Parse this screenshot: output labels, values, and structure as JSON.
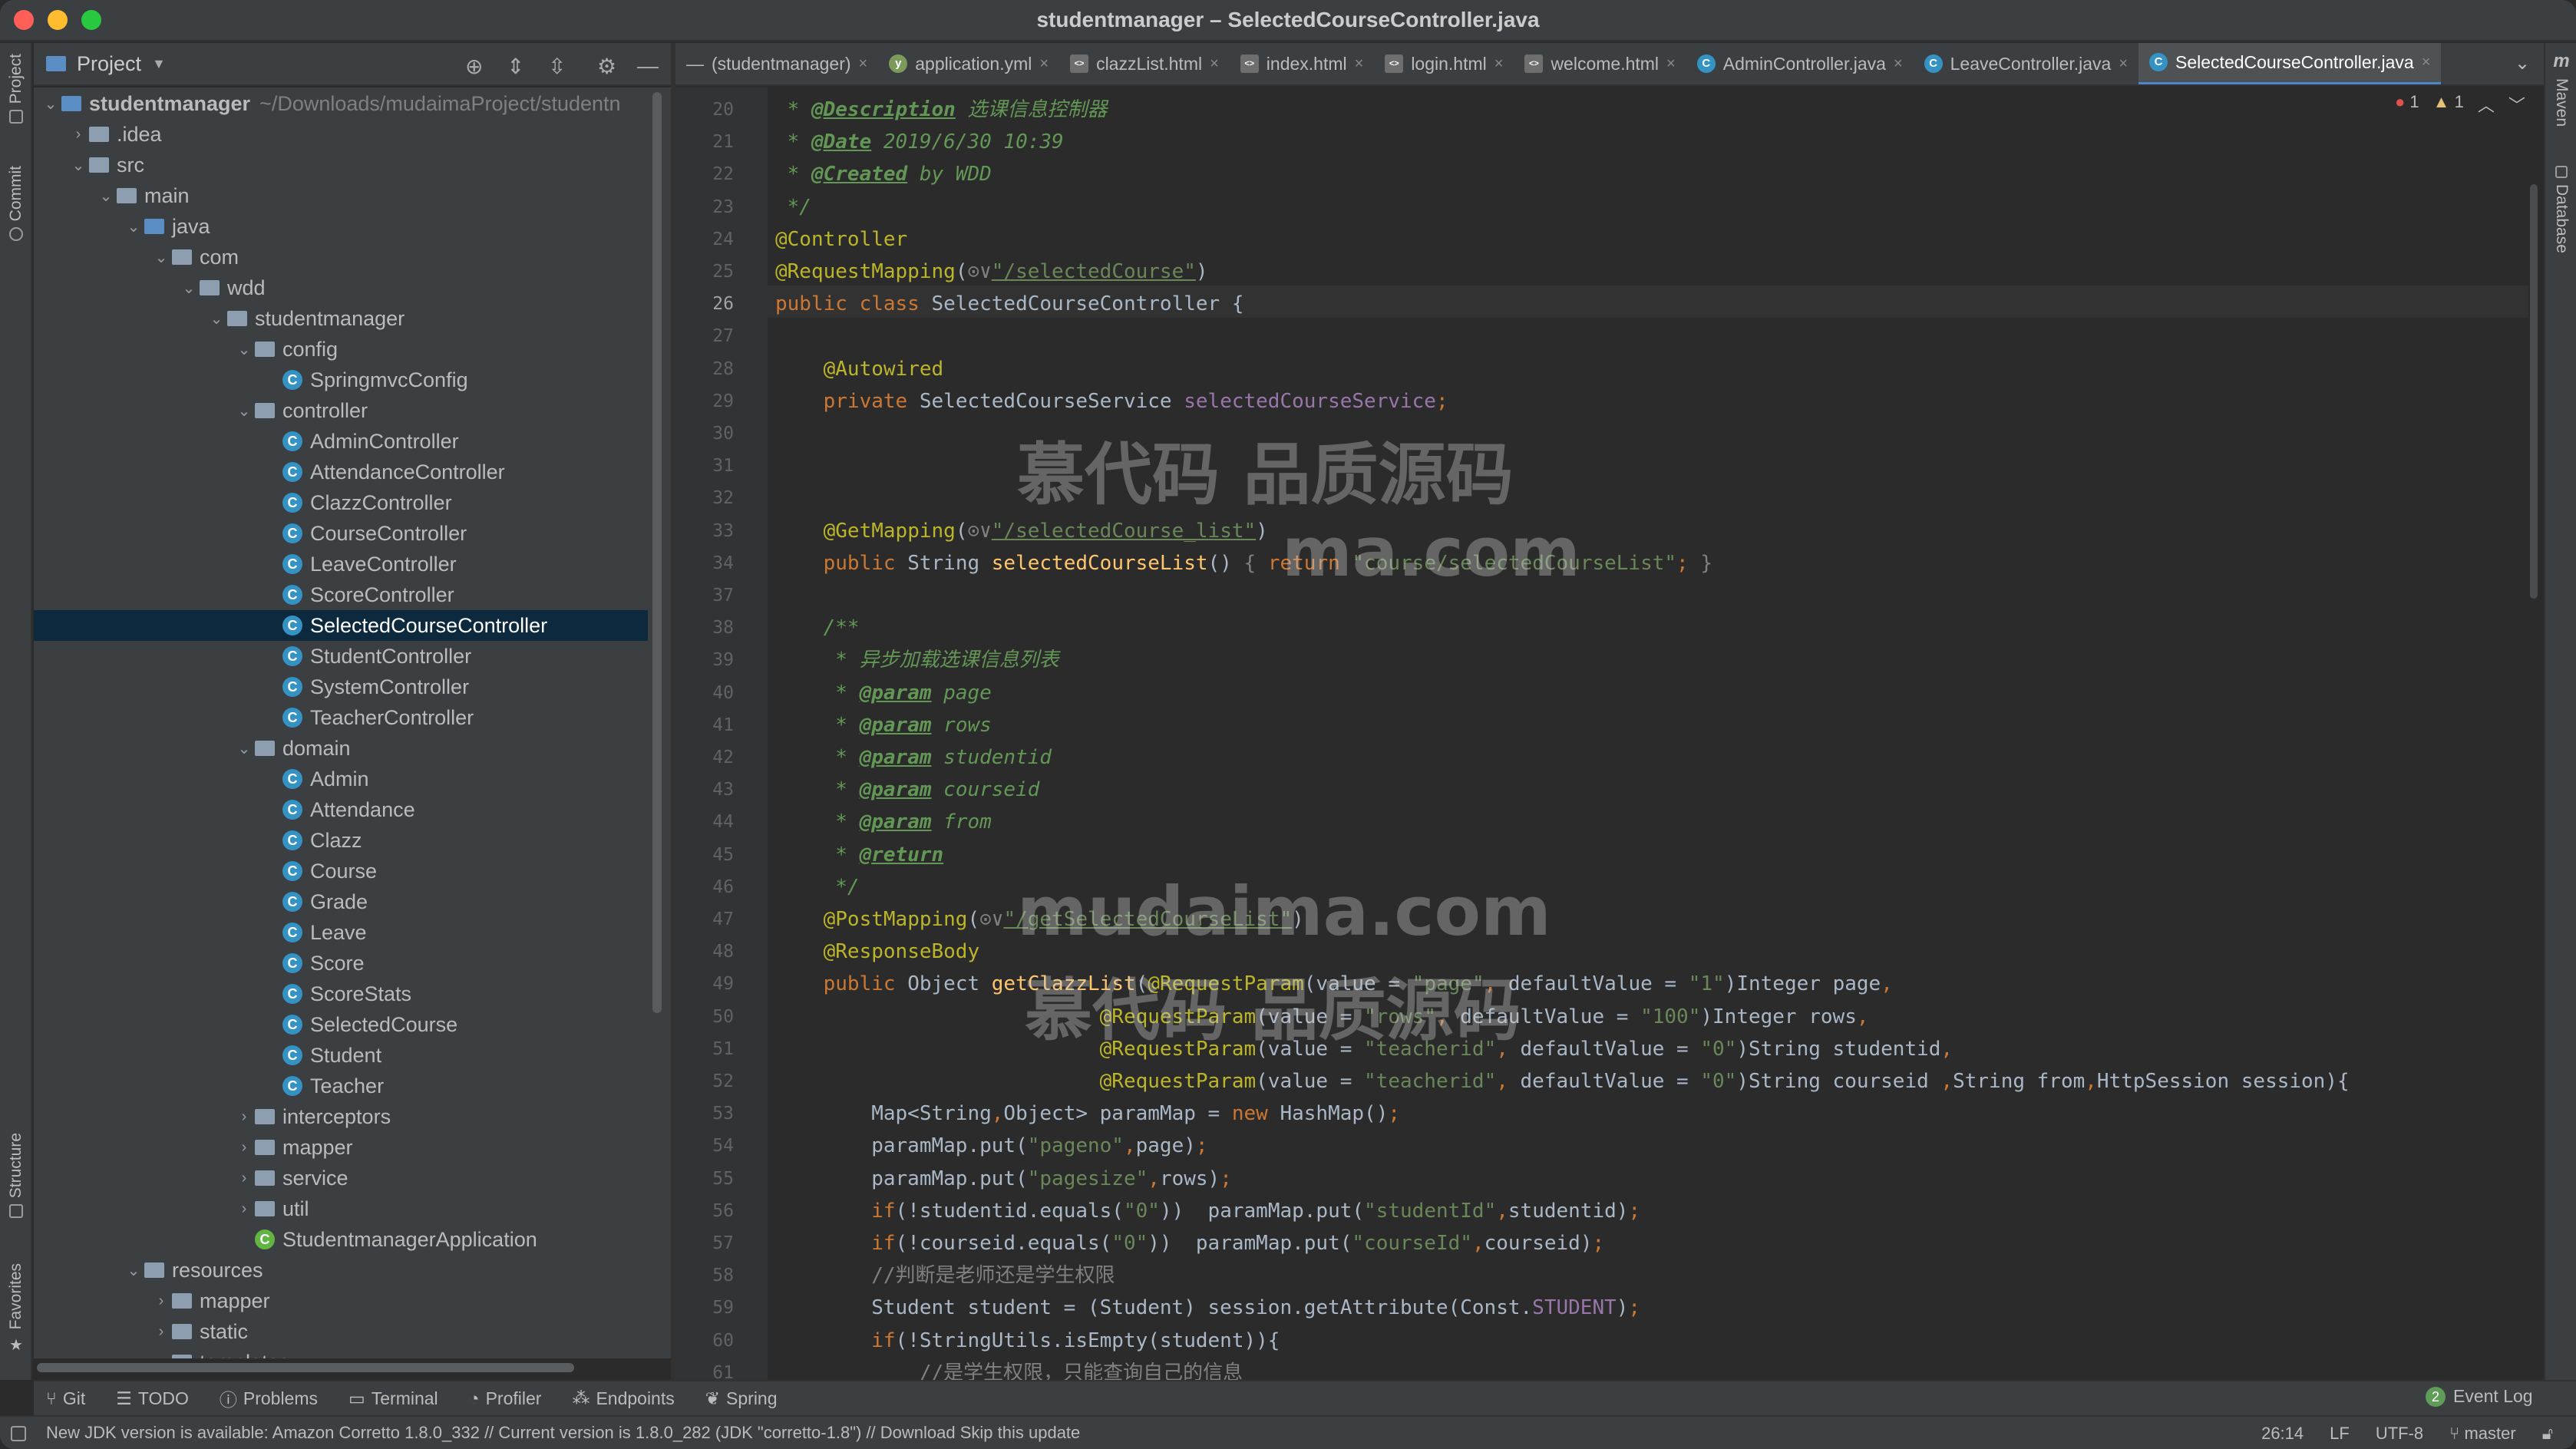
{
  "window": {
    "title": "studentmanager – SelectedCourseController.java"
  },
  "left_strip": {
    "project": "Project",
    "commit": "Commit",
    "structure": "Structure",
    "favorites": "Favorites"
  },
  "right_strip": {
    "maven": "Maven",
    "database": "Database"
  },
  "project_panel": {
    "label": "Project"
  },
  "tree": [
    {
      "label": "studentmanager",
      "suffix": "~/Downloads/mudaimaProject/studentn",
      "indent": 0,
      "type": "module",
      "open": true,
      "bold": true
    },
    {
      "label": ".idea",
      "indent": 1,
      "type": "folder",
      "open": false
    },
    {
      "label": "src",
      "indent": 1,
      "type": "folder",
      "open": true
    },
    {
      "label": "main",
      "indent": 2,
      "type": "folder",
      "open": true
    },
    {
      "label": "java",
      "indent": 3,
      "type": "folder-blue",
      "open": true
    },
    {
      "label": "com",
      "indent": 4,
      "type": "folder",
      "open": true
    },
    {
      "label": "wdd",
      "indent": 5,
      "type": "folder",
      "open": true
    },
    {
      "label": "studentmanager",
      "indent": 6,
      "type": "folder",
      "open": true
    },
    {
      "label": "config",
      "indent": 7,
      "type": "folder",
      "open": true
    },
    {
      "label": "SpringmvcConfig",
      "indent": 8,
      "type": "class"
    },
    {
      "label": "controller",
      "indent": 7,
      "type": "folder",
      "open": true
    },
    {
      "label": "AdminController",
      "indent": 8,
      "type": "class"
    },
    {
      "label": "AttendanceController",
      "indent": 8,
      "type": "class"
    },
    {
      "label": "ClazzController",
      "indent": 8,
      "type": "class"
    },
    {
      "label": "CourseController",
      "indent": 8,
      "type": "class"
    },
    {
      "label": "LeaveController",
      "indent": 8,
      "type": "class"
    },
    {
      "label": "ScoreController",
      "indent": 8,
      "type": "class"
    },
    {
      "label": "SelectedCourseController",
      "indent": 8,
      "type": "class",
      "selected": true
    },
    {
      "label": "StudentController",
      "indent": 8,
      "type": "class"
    },
    {
      "label": "SystemController",
      "indent": 8,
      "type": "class"
    },
    {
      "label": "TeacherController",
      "indent": 8,
      "type": "class"
    },
    {
      "label": "domain",
      "indent": 7,
      "type": "folder",
      "open": true
    },
    {
      "label": "Admin",
      "indent": 8,
      "type": "class"
    },
    {
      "label": "Attendance",
      "indent": 8,
      "type": "class"
    },
    {
      "label": "Clazz",
      "indent": 8,
      "type": "class"
    },
    {
      "label": "Course",
      "indent": 8,
      "type": "class"
    },
    {
      "label": "Grade",
      "indent": 8,
      "type": "class"
    },
    {
      "label": "Leave",
      "indent": 8,
      "type": "class"
    },
    {
      "label": "Score",
      "indent": 8,
      "type": "class"
    },
    {
      "label": "ScoreStats",
      "indent": 8,
      "type": "class"
    },
    {
      "label": "SelectedCourse",
      "indent": 8,
      "type": "class"
    },
    {
      "label": "Student",
      "indent": 8,
      "type": "class"
    },
    {
      "label": "Teacher",
      "indent": 8,
      "type": "class"
    },
    {
      "label": "interceptors",
      "indent": 7,
      "type": "folder",
      "open": false
    },
    {
      "label": "mapper",
      "indent": 7,
      "type": "folder",
      "open": false
    },
    {
      "label": "service",
      "indent": 7,
      "type": "folder",
      "open": false
    },
    {
      "label": "util",
      "indent": 7,
      "type": "folder",
      "open": false
    },
    {
      "label": "StudentmanagerApplication",
      "indent": 7,
      "type": "spring"
    },
    {
      "label": "resources",
      "indent": 3,
      "type": "folder",
      "open": true
    },
    {
      "label": "mapper",
      "indent": 4,
      "type": "folder",
      "open": false
    },
    {
      "label": "static",
      "indent": 4,
      "type": "folder",
      "open": false
    },
    {
      "label": "templates",
      "indent": 4,
      "type": "folder",
      "open": true
    }
  ],
  "tabs": [
    {
      "label": "(studentmanager)",
      "icon": "minus"
    },
    {
      "label": "application.yml",
      "icon": "yml"
    },
    {
      "label": "clazzList.html",
      "icon": "html"
    },
    {
      "label": "index.html",
      "icon": "html"
    },
    {
      "label": "login.html",
      "icon": "html"
    },
    {
      "label": "welcome.html",
      "icon": "html"
    },
    {
      "label": "AdminController.java",
      "icon": "class"
    },
    {
      "label": "LeaveController.java",
      "icon": "class"
    },
    {
      "label": "SelectedCourseController.java",
      "icon": "class",
      "active": true
    }
  ],
  "editor": {
    "errors": "1",
    "warnings": "1",
    "current_line": "26",
    "lines": [
      {
        "n": "20",
        "t": [
          [
            "cmt",
            " * "
          ],
          [
            "tag",
            "@Description"
          ],
          [
            "cmt",
            " 选课信息控制器"
          ]
        ]
      },
      {
        "n": "21",
        "t": [
          [
            "cmt",
            " * "
          ],
          [
            "tag",
            "@Date"
          ],
          [
            "cmt",
            " 2019/6/30 10:39"
          ]
        ]
      },
      {
        "n": "22",
        "t": [
          [
            "cmt",
            " * "
          ],
          [
            "tag",
            "@Created"
          ],
          [
            "cmt",
            " by WDD"
          ]
        ]
      },
      {
        "n": "23",
        "t": [
          [
            "cmt",
            " */"
          ]
        ]
      },
      {
        "n": "24",
        "t": [
          [
            "ann",
            "@Controller"
          ]
        ]
      },
      {
        "n": "25",
        "t": [
          [
            "ann",
            "@RequestMapping"
          ],
          [
            "",
            "("
          ],
          [
            "gray",
            "⊙∨"
          ],
          [
            "url",
            "\"/selectedCourse\""
          ],
          [
            "",
            ")"
          ]
        ]
      },
      {
        "n": "26",
        "t": [
          [
            "kw",
            "public class "
          ],
          [
            "",
            "SelectedCourseController {"
          ]
        ]
      },
      {
        "n": "27",
        "t": []
      },
      {
        "n": "28",
        "t": [
          [
            "",
            "    "
          ],
          [
            "ann",
            "@Autowired"
          ]
        ]
      },
      {
        "n": "29",
        "t": [
          [
            "",
            "    "
          ],
          [
            "kw",
            "private "
          ],
          [
            "",
            "SelectedCourseService "
          ],
          [
            "fld",
            "selectedCourseService"
          ],
          [
            "kw",
            ";"
          ]
        ]
      },
      {
        "n": "30",
        "t": []
      },
      {
        "n": "31",
        "t": []
      },
      {
        "n": "32",
        "t": []
      },
      {
        "n": "33",
        "t": [
          [
            "",
            "    "
          ],
          [
            "ann",
            "@GetMapping"
          ],
          [
            "",
            "("
          ],
          [
            "gray",
            "⊙∨"
          ],
          [
            "url",
            "\"/selectedCourse_list\""
          ],
          [
            "",
            ")"
          ]
        ]
      },
      {
        "n": "34",
        "t": [
          [
            "",
            "    "
          ],
          [
            "kw",
            "public "
          ],
          [
            "",
            "String "
          ],
          [
            "mth",
            "selectedCourseList"
          ],
          [
            "",
            "() "
          ],
          [
            "gray",
            "{ "
          ],
          [
            "kw",
            "return "
          ],
          [
            "str",
            "\"course/selectedCourseList\""
          ],
          [
            "kw",
            "; "
          ],
          [
            "gray",
            "}"
          ]
        ]
      },
      {
        "n": "37",
        "t": []
      },
      {
        "n": "38",
        "t": [
          [
            "",
            "    "
          ],
          [
            "cmt",
            "/**"
          ]
        ]
      },
      {
        "n": "39",
        "t": [
          [
            "",
            "    "
          ],
          [
            "cmt",
            " * 异步加载选课信息列表"
          ]
        ]
      },
      {
        "n": "40",
        "t": [
          [
            "",
            "    "
          ],
          [
            "cmt",
            " * "
          ],
          [
            "tag",
            "@param"
          ],
          [
            "cmt",
            " page"
          ]
        ]
      },
      {
        "n": "41",
        "t": [
          [
            "",
            "    "
          ],
          [
            "cmt",
            " * "
          ],
          [
            "tag",
            "@param"
          ],
          [
            "cmt",
            " rows"
          ]
        ]
      },
      {
        "n": "42",
        "t": [
          [
            "",
            "    "
          ],
          [
            "cmt",
            " * "
          ],
          [
            "tag",
            "@param"
          ],
          [
            "cmt",
            " studentid"
          ]
        ]
      },
      {
        "n": "43",
        "t": [
          [
            "",
            "    "
          ],
          [
            "cmt",
            " * "
          ],
          [
            "tag",
            "@param"
          ],
          [
            "cmt",
            " courseid"
          ]
        ]
      },
      {
        "n": "44",
        "t": [
          [
            "",
            "    "
          ],
          [
            "cmt",
            " * "
          ],
          [
            "tag",
            "@param"
          ],
          [
            "cmt",
            " from"
          ]
        ]
      },
      {
        "n": "45",
        "t": [
          [
            "",
            "    "
          ],
          [
            "cmt",
            " * "
          ],
          [
            "tag",
            "@return"
          ]
        ]
      },
      {
        "n": "46",
        "t": [
          [
            "",
            "    "
          ],
          [
            "cmt",
            " */"
          ]
        ]
      },
      {
        "n": "47",
        "t": [
          [
            "",
            "    "
          ],
          [
            "ann",
            "@PostMapping"
          ],
          [
            "",
            "("
          ],
          [
            "gray",
            "⊙∨"
          ],
          [
            "url",
            "\"/getSelectedCourseList\""
          ],
          [
            "",
            ")"
          ]
        ]
      },
      {
        "n": "48",
        "t": [
          [
            "",
            "    "
          ],
          [
            "ann",
            "@ResponseBody"
          ]
        ]
      },
      {
        "n": "49",
        "t": [
          [
            "",
            "    "
          ],
          [
            "kw",
            "public "
          ],
          [
            "",
            "Object "
          ],
          [
            "mth",
            "getClazzList"
          ],
          [
            "",
            "("
          ],
          [
            "ann",
            "@RequestParam"
          ],
          [
            "",
            "(value = "
          ],
          [
            "str",
            "\"page\""
          ],
          [
            "kw",
            ", "
          ],
          [
            "",
            "defaultValue = "
          ],
          [
            "str",
            "\"1\""
          ],
          [
            "",
            ")Integer page"
          ],
          [
            "kw",
            ","
          ]
        ]
      },
      {
        "n": "50",
        "t": [
          [
            "",
            "                           "
          ],
          [
            "ann",
            "@RequestParam"
          ],
          [
            "",
            "(value = "
          ],
          [
            "str",
            "\"rows\""
          ],
          [
            "kw",
            ", "
          ],
          [
            "",
            "defaultValue = "
          ],
          [
            "str",
            "\"100\""
          ],
          [
            "",
            ")Integer rows"
          ],
          [
            "kw",
            ","
          ]
        ]
      },
      {
        "n": "51",
        "t": [
          [
            "",
            "                           "
          ],
          [
            "ann",
            "@RequestParam"
          ],
          [
            "",
            "(value = "
          ],
          [
            "str",
            "\"teacherid\""
          ],
          [
            "kw",
            ", "
          ],
          [
            "",
            "defaultValue = "
          ],
          [
            "str",
            "\"0\""
          ],
          [
            "",
            ")String studentid"
          ],
          [
            "kw",
            ","
          ]
        ]
      },
      {
        "n": "52",
        "t": [
          [
            "",
            "                           "
          ],
          [
            "ann",
            "@RequestParam"
          ],
          [
            "",
            "(value = "
          ],
          [
            "str",
            "\"teacherid\""
          ],
          [
            "kw",
            ", "
          ],
          [
            "",
            "defaultValue = "
          ],
          [
            "str",
            "\"0\""
          ],
          [
            "",
            ")String courseid "
          ],
          [
            "kw",
            ","
          ],
          [
            "",
            "String from"
          ],
          [
            "kw",
            ","
          ],
          [
            "",
            "HttpSession session){"
          ]
        ]
      },
      {
        "n": "53",
        "t": [
          [
            "",
            "        Map<String"
          ],
          [
            "kw",
            ","
          ],
          [
            "",
            "Object> paramMap = "
          ],
          [
            "kw",
            "new "
          ],
          [
            "",
            "HashMap()"
          ],
          [
            "kw",
            ";"
          ]
        ]
      },
      {
        "n": "54",
        "t": [
          [
            "",
            "        paramMap.put("
          ],
          [
            "str",
            "\"pageno\""
          ],
          [
            "kw",
            ","
          ],
          [
            "",
            "page)"
          ],
          [
            "kw",
            ";"
          ]
        ]
      },
      {
        "n": "55",
        "t": [
          [
            "",
            "        paramMap.put("
          ],
          [
            "str",
            "\"pagesize\""
          ],
          [
            "kw",
            ","
          ],
          [
            "",
            "rows)"
          ],
          [
            "kw",
            ";"
          ]
        ]
      },
      {
        "n": "56",
        "t": [
          [
            "",
            "        "
          ],
          [
            "kw",
            "if"
          ],
          [
            "",
            "(!studentid.equals("
          ],
          [
            "str",
            "\"0\""
          ],
          [
            "",
            "))  paramMap.put("
          ],
          [
            "str",
            "\"studentId\""
          ],
          [
            "kw",
            ","
          ],
          [
            "",
            "studentid)"
          ],
          [
            "kw",
            ";"
          ]
        ]
      },
      {
        "n": "57",
        "t": [
          [
            "",
            "        "
          ],
          [
            "kw",
            "if"
          ],
          [
            "",
            "(!courseid.equals("
          ],
          [
            "str",
            "\"0\""
          ],
          [
            "",
            "))  paramMap.put("
          ],
          [
            "str",
            "\"courseId\""
          ],
          [
            "kw",
            ","
          ],
          [
            "",
            "courseid)"
          ],
          [
            "kw",
            ";"
          ]
        ]
      },
      {
        "n": "58",
        "t": [
          [
            "",
            "        "
          ],
          [
            "lcmt",
            "//判断是老师还是学生权限"
          ]
        ]
      },
      {
        "n": "59",
        "t": [
          [
            "",
            "        Student student = (Student) session.getAttribute(Const."
          ],
          [
            "fld",
            "STUDENT"
          ],
          [
            "",
            ")"
          ],
          [
            "kw",
            ";"
          ]
        ]
      },
      {
        "n": "60",
        "t": [
          [
            "",
            "        "
          ],
          [
            "kw",
            "if"
          ],
          [
            "",
            "(!StringUtils.isEmpty(student)){"
          ]
        ]
      },
      {
        "n": "61",
        "t": [
          [
            "",
            "            "
          ],
          [
            "lcmt",
            "//是学生权限，只能查询自己的信息"
          ]
        ]
      }
    ]
  },
  "watermark": {
    "cn": "慕代码 品质源码",
    "domain": "mudaima.com",
    "domain_partial": "ma.com"
  },
  "bottom_tools": [
    "Git",
    "TODO",
    "Problems",
    "Terminal",
    "Profiler",
    "Endpoints",
    "Spring"
  ],
  "event_log": {
    "count": "2",
    "label": "Event Log"
  },
  "status": {
    "message": "New JDK version is available: Amazon Corretto 1.8.0_332 // Current version is 1.8.0_282 (JDK \"corretto-1.8\") // Download   Skip this update",
    "position": "26:14",
    "line_sep": "LF",
    "encoding": "UTF-8",
    "branch": "master"
  }
}
